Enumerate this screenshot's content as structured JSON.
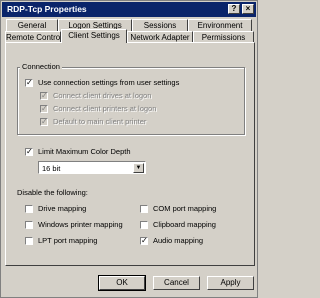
{
  "window": {
    "title": "RDP-Tcp Properties"
  },
  "title_buttons": {
    "help": "?",
    "close": "×"
  },
  "tabs_row1": [
    "General",
    "Logon Settings",
    "Sessions",
    "Environment"
  ],
  "tabs_row2": [
    "Remote Control",
    "Client Settings",
    "Network Adapter",
    "Permissions"
  ],
  "connection": {
    "label": "Connection",
    "use_connection_settings": {
      "label": "Use connection settings from user settings",
      "checked": true
    },
    "sub_items": [
      {
        "label": "Connect client drives at logon",
        "checked": true
      },
      {
        "label": "Connect client printers at logon",
        "checked": true
      },
      {
        "label": "Default to main client printer",
        "checked": true
      }
    ]
  },
  "color_depth": {
    "label": "Limit Maximum Color Depth",
    "checked": true,
    "value": "16 bit"
  },
  "disable_mapping": {
    "label": "Disable the following:",
    "items": [
      {
        "label": "Drive mapping",
        "checked": false
      },
      {
        "label": "COM port mapping",
        "checked": false
      },
      {
        "label": "Windows printer mapping",
        "checked": false
      },
      {
        "label": "Clipboard mapping",
        "checked": false
      },
      {
        "label": "LPT port mapping",
        "checked": false
      },
      {
        "label": "Audio mapping",
        "checked": true
      }
    ]
  },
  "buttons": {
    "ok": "OK",
    "cancel": "Cancel",
    "apply": "Apply"
  },
  "check_glyph": "✓"
}
